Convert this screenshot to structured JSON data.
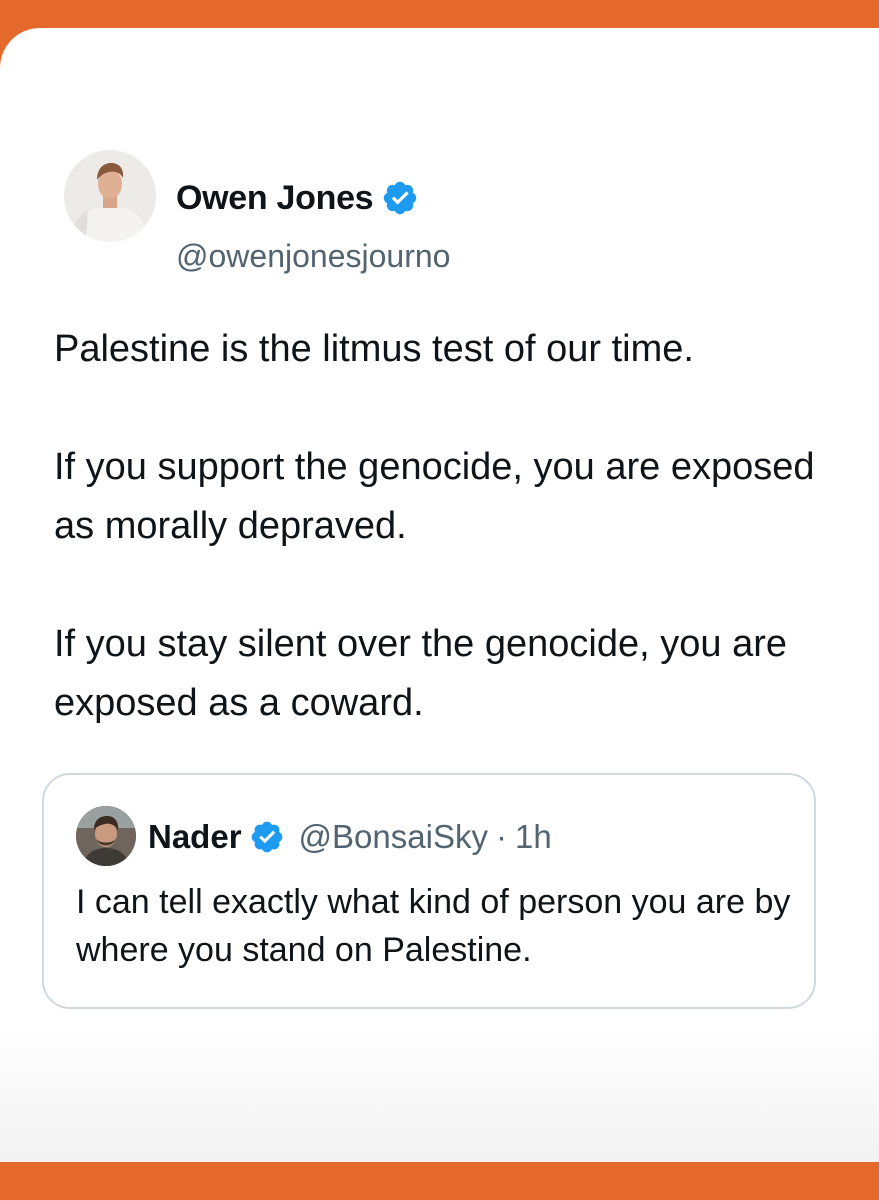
{
  "colors": {
    "frame": "#e4692a",
    "card": "#ffffff",
    "verified_blue": "#1d9bf0",
    "text_primary": "#0f1419",
    "text_secondary": "#536471",
    "quote_border": "#cfd9de"
  },
  "tweet": {
    "author": {
      "display_name": "Owen Jones",
      "handle": "@owenjonesjourno",
      "verified": true,
      "avatar_icon": "profile-photo-avatar"
    },
    "paragraphs": [
      "Palestine is the litmus test of our time.",
      "If you support the genocide, you are exposed as morally depraved.",
      "If you stay silent over the genocide, you are exposed as a coward."
    ]
  },
  "quoted_tweet": {
    "author": {
      "display_name": "Nader",
      "handle": "@BonsaiSky",
      "verified": true,
      "avatar_icon": "profile-photo-avatar"
    },
    "separator": "·",
    "time": "1h",
    "text": "I can tell exactly what kind of person you are by where you stand on Palestine."
  }
}
